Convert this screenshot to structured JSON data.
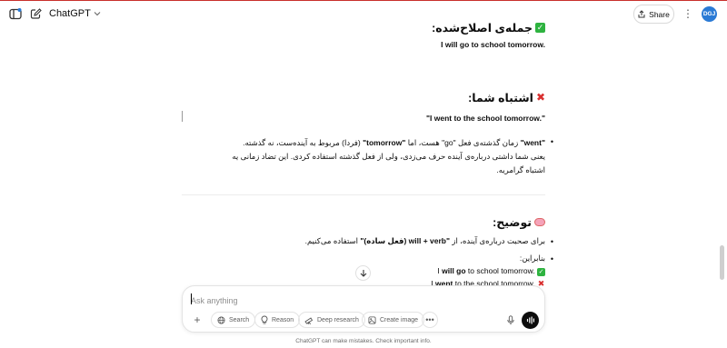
{
  "header": {
    "model_label": "ChatGPT",
    "share_label": "Share",
    "avatar_initials": "DGJ"
  },
  "content": {
    "corrected_heading": "جمله‌ی اصلاح‌شده:",
    "corrected_sentence": "I will go to school tomorrow.",
    "mistake_heading": "اشتباه شما:",
    "mistake_quote": "\"I went to the school tomorrow.\"",
    "mistake_bullet": {
      "went": "\"went\"",
      "part1": " زمان گذشته‌ی فعل \"go\" هست، اما ",
      "tomorrow": "\"tomorrow\"",
      "part2": " (فردا) مربوط به آینده‌ست، نه گذشته.",
      "line2": "یعنی شما داشتی درباره‌ی آینده حرف می‌زدی، ولی از فعل گذشته استفاده کردی. این تضاد زمانی یه اشتباه گرامریه."
    },
    "explain_heading": "توضیح:",
    "explain_bullet1": {
      "part1": "برای صحبت درباره‌ی آینده، از ",
      "bold": "\"will + verb (فعل ساده)\"",
      "part2": " استفاده می‌کنیم."
    },
    "explain_bullet2_label": "بنابراین:",
    "example_correct": {
      "pre": "I ",
      "bold": "will go",
      "post": " to school tomorrow."
    },
    "example_wrong": {
      "pre": "I ",
      "bold": "went",
      "post": " to the school tomorrow."
    }
  },
  "composer": {
    "placeholder": "Ask anything",
    "tools": {
      "search": "Search",
      "reason": "Reason",
      "deep_research": "Deep research",
      "create_image": "Create image"
    }
  },
  "footer": "ChatGPT can make mistakes. Check important info.",
  "icons": [
    "sidebar-toggle-icon",
    "new-chat-icon",
    "chevron-down-icon",
    "share-icon",
    "more-vertical-icon",
    "check-mark-emoji-icon",
    "cross-mark-emoji-icon",
    "speech-bubble-emoji-icon",
    "arrow-down-icon",
    "plus-icon",
    "globe-icon",
    "lightbulb-icon",
    "telescope-icon",
    "image-icon",
    "more-horizontal-icon",
    "mic-icon",
    "voice-mode-icon"
  ],
  "colors": {
    "accent_blue": "#2a7ad5",
    "check_green": "#2eb340",
    "cross_red": "#d93030",
    "top_line_red": "#c9302c"
  }
}
